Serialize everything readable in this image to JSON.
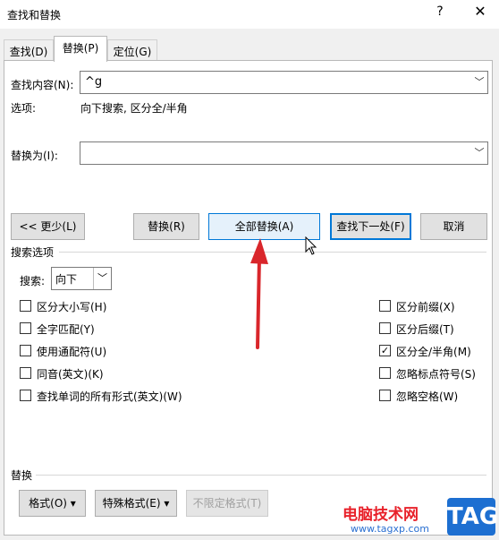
{
  "window": {
    "title": "查找和替换",
    "help_label": "?",
    "close_label": "✕"
  },
  "tabs": [
    {
      "label": "查找(D)",
      "active": false
    },
    {
      "label": "替换(P)",
      "active": true
    },
    {
      "label": "定位(G)",
      "active": false
    }
  ],
  "find": {
    "label": "查找内容(N):",
    "value": "^g",
    "options_label": "选项:",
    "options_value": "向下搜索, 区分全/半角"
  },
  "replace": {
    "label": "替换为(I):",
    "value": ""
  },
  "buttons": {
    "less": "<< 更少(L)",
    "replace": "替换(R)",
    "replace_all": "全部替换(A)",
    "find_next": "查找下一处(F)",
    "cancel": "取消"
  },
  "search_options": {
    "header": "搜索选项",
    "direction_label": "搜索:",
    "direction_value": "向下",
    "left_checks": [
      {
        "label": "区分大小写(H)",
        "checked": false
      },
      {
        "label": "全字匹配(Y)",
        "checked": false
      },
      {
        "label": "使用通配符(U)",
        "checked": false
      },
      {
        "label": "同音(英文)(K)",
        "checked": false
      },
      {
        "label": "查找单词的所有形式(英文)(W)",
        "checked": false
      }
    ],
    "right_checks": [
      {
        "label": "区分前缀(X)",
        "checked": false
      },
      {
        "label": "区分后缀(T)",
        "checked": false
      },
      {
        "label": "区分全/半角(M)",
        "checked": true
      },
      {
        "label": "忽略标点符号(S)",
        "checked": false
      },
      {
        "label": "忽略空格(W)",
        "checked": false
      }
    ]
  },
  "replace_section": {
    "header": "替换",
    "format_button": "格式(O) ▾",
    "special_button": "特殊格式(E) ▾",
    "no_format_button": "不限定格式(T)"
  },
  "watermark": {
    "site_name": "电脑技术网",
    "url": "www.tagxp.com",
    "badge": "TAG"
  },
  "colors": {
    "accent": "#0078d7",
    "arrow": "#d9262b",
    "badge_bg": "#1d6fd1"
  }
}
